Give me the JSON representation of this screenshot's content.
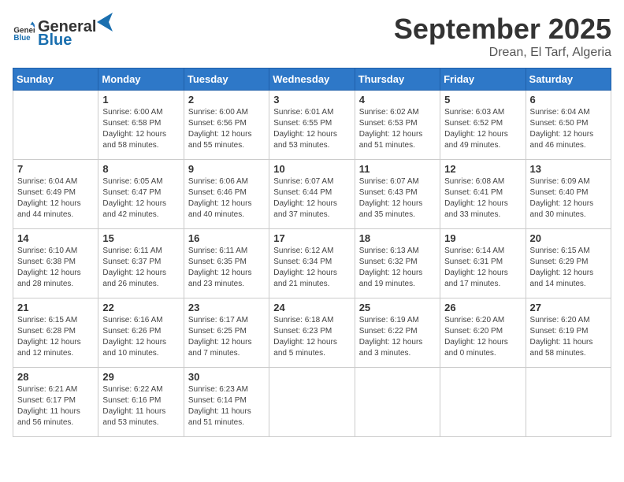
{
  "logo": {
    "general": "General",
    "blue": "Blue"
  },
  "title": "September 2025",
  "location": "Drean, El Tarf, Algeria",
  "days_of_week": [
    "Sunday",
    "Monday",
    "Tuesday",
    "Wednesday",
    "Thursday",
    "Friday",
    "Saturday"
  ],
  "weeks": [
    [
      {
        "day": "",
        "info": ""
      },
      {
        "day": "1",
        "info": "Sunrise: 6:00 AM\nSunset: 6:58 PM\nDaylight: 12 hours and 58 minutes."
      },
      {
        "day": "2",
        "info": "Sunrise: 6:00 AM\nSunset: 6:56 PM\nDaylight: 12 hours and 55 minutes."
      },
      {
        "day": "3",
        "info": "Sunrise: 6:01 AM\nSunset: 6:55 PM\nDaylight: 12 hours and 53 minutes."
      },
      {
        "day": "4",
        "info": "Sunrise: 6:02 AM\nSunset: 6:53 PM\nDaylight: 12 hours and 51 minutes."
      },
      {
        "day": "5",
        "info": "Sunrise: 6:03 AM\nSunset: 6:52 PM\nDaylight: 12 hours and 49 minutes."
      },
      {
        "day": "6",
        "info": "Sunrise: 6:04 AM\nSunset: 6:50 PM\nDaylight: 12 hours and 46 minutes."
      }
    ],
    [
      {
        "day": "7",
        "info": "Sunrise: 6:04 AM\nSunset: 6:49 PM\nDaylight: 12 hours and 44 minutes."
      },
      {
        "day": "8",
        "info": "Sunrise: 6:05 AM\nSunset: 6:47 PM\nDaylight: 12 hours and 42 minutes."
      },
      {
        "day": "9",
        "info": "Sunrise: 6:06 AM\nSunset: 6:46 PM\nDaylight: 12 hours and 40 minutes."
      },
      {
        "day": "10",
        "info": "Sunrise: 6:07 AM\nSunset: 6:44 PM\nDaylight: 12 hours and 37 minutes."
      },
      {
        "day": "11",
        "info": "Sunrise: 6:07 AM\nSunset: 6:43 PM\nDaylight: 12 hours and 35 minutes."
      },
      {
        "day": "12",
        "info": "Sunrise: 6:08 AM\nSunset: 6:41 PM\nDaylight: 12 hours and 33 minutes."
      },
      {
        "day": "13",
        "info": "Sunrise: 6:09 AM\nSunset: 6:40 PM\nDaylight: 12 hours and 30 minutes."
      }
    ],
    [
      {
        "day": "14",
        "info": "Sunrise: 6:10 AM\nSunset: 6:38 PM\nDaylight: 12 hours and 28 minutes."
      },
      {
        "day": "15",
        "info": "Sunrise: 6:11 AM\nSunset: 6:37 PM\nDaylight: 12 hours and 26 minutes."
      },
      {
        "day": "16",
        "info": "Sunrise: 6:11 AM\nSunset: 6:35 PM\nDaylight: 12 hours and 23 minutes."
      },
      {
        "day": "17",
        "info": "Sunrise: 6:12 AM\nSunset: 6:34 PM\nDaylight: 12 hours and 21 minutes."
      },
      {
        "day": "18",
        "info": "Sunrise: 6:13 AM\nSunset: 6:32 PM\nDaylight: 12 hours and 19 minutes."
      },
      {
        "day": "19",
        "info": "Sunrise: 6:14 AM\nSunset: 6:31 PM\nDaylight: 12 hours and 17 minutes."
      },
      {
        "day": "20",
        "info": "Sunrise: 6:15 AM\nSunset: 6:29 PM\nDaylight: 12 hours and 14 minutes."
      }
    ],
    [
      {
        "day": "21",
        "info": "Sunrise: 6:15 AM\nSunset: 6:28 PM\nDaylight: 12 hours and 12 minutes."
      },
      {
        "day": "22",
        "info": "Sunrise: 6:16 AM\nSunset: 6:26 PM\nDaylight: 12 hours and 10 minutes."
      },
      {
        "day": "23",
        "info": "Sunrise: 6:17 AM\nSunset: 6:25 PM\nDaylight: 12 hours and 7 minutes."
      },
      {
        "day": "24",
        "info": "Sunrise: 6:18 AM\nSunset: 6:23 PM\nDaylight: 12 hours and 5 minutes."
      },
      {
        "day": "25",
        "info": "Sunrise: 6:19 AM\nSunset: 6:22 PM\nDaylight: 12 hours and 3 minutes."
      },
      {
        "day": "26",
        "info": "Sunrise: 6:20 AM\nSunset: 6:20 PM\nDaylight: 12 hours and 0 minutes."
      },
      {
        "day": "27",
        "info": "Sunrise: 6:20 AM\nSunset: 6:19 PM\nDaylight: 11 hours and 58 minutes."
      }
    ],
    [
      {
        "day": "28",
        "info": "Sunrise: 6:21 AM\nSunset: 6:17 PM\nDaylight: 11 hours and 56 minutes."
      },
      {
        "day": "29",
        "info": "Sunrise: 6:22 AM\nSunset: 6:16 PM\nDaylight: 11 hours and 53 minutes."
      },
      {
        "day": "30",
        "info": "Sunrise: 6:23 AM\nSunset: 6:14 PM\nDaylight: 11 hours and 51 minutes."
      },
      {
        "day": "",
        "info": ""
      },
      {
        "day": "",
        "info": ""
      },
      {
        "day": "",
        "info": ""
      },
      {
        "day": "",
        "info": ""
      }
    ]
  ]
}
